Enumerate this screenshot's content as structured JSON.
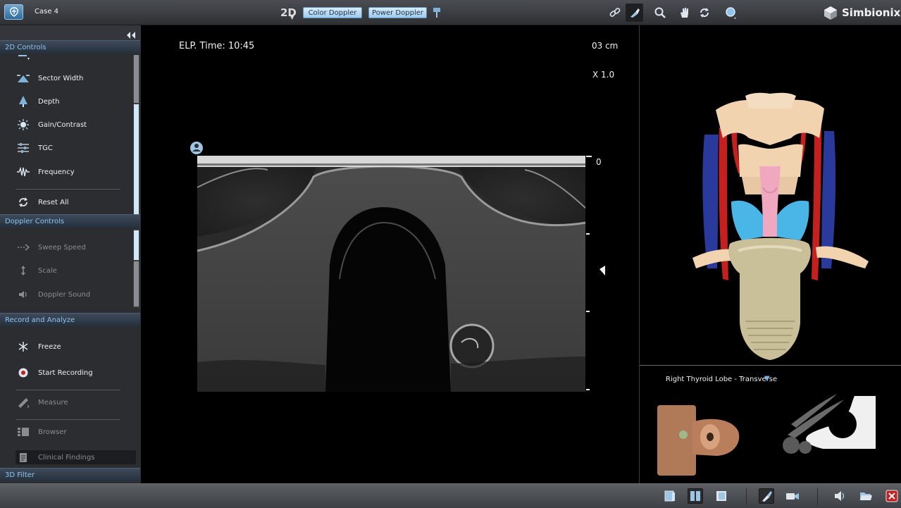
{
  "toolbar": {
    "case_title": "Case 4",
    "mode_2d": "2D",
    "color_doppler": "Color Doppler",
    "power_doppler": "Power Doppler",
    "brand": "Simbionix"
  },
  "left_panel": {
    "sections": {
      "controls_2d": "2D Controls",
      "doppler_controls": "Doppler Controls",
      "record_analyze": "Record and Analyze",
      "filter_3d": "3D Filter"
    },
    "controls_2d_items": [
      "Sector Width",
      "Depth",
      "Gain/Contrast",
      "TGC",
      "Frequency"
    ],
    "reset_all": "Reset All",
    "doppler_items": [
      "Sweep Speed",
      "Scale",
      "Doppler Sound"
    ],
    "record_items": {
      "freeze": "Freeze",
      "start_recording": "Start Recording",
      "measure": "Measure",
      "browser": "Browser",
      "clinical_findings": "Clinical Findings"
    }
  },
  "ultrasound": {
    "elapsed_time": "ELP. Time: 10:45",
    "depth": "03 cm",
    "zoom": "X 1.0",
    "scale_zero": "0"
  },
  "views": {
    "probe_view_title": "Right Thyroid Lobe - Transverse"
  },
  "colors": {
    "accent": "#8fc4f0",
    "button_fill": "#b9dcf5",
    "vessel_red": "#c4201f",
    "vessel_blue": "#2a3a9c",
    "thyroid": "#4ab6e8",
    "trachea": "#f0a8c0",
    "bone": "#f1d3b0",
    "probe": "#c9c09a"
  }
}
